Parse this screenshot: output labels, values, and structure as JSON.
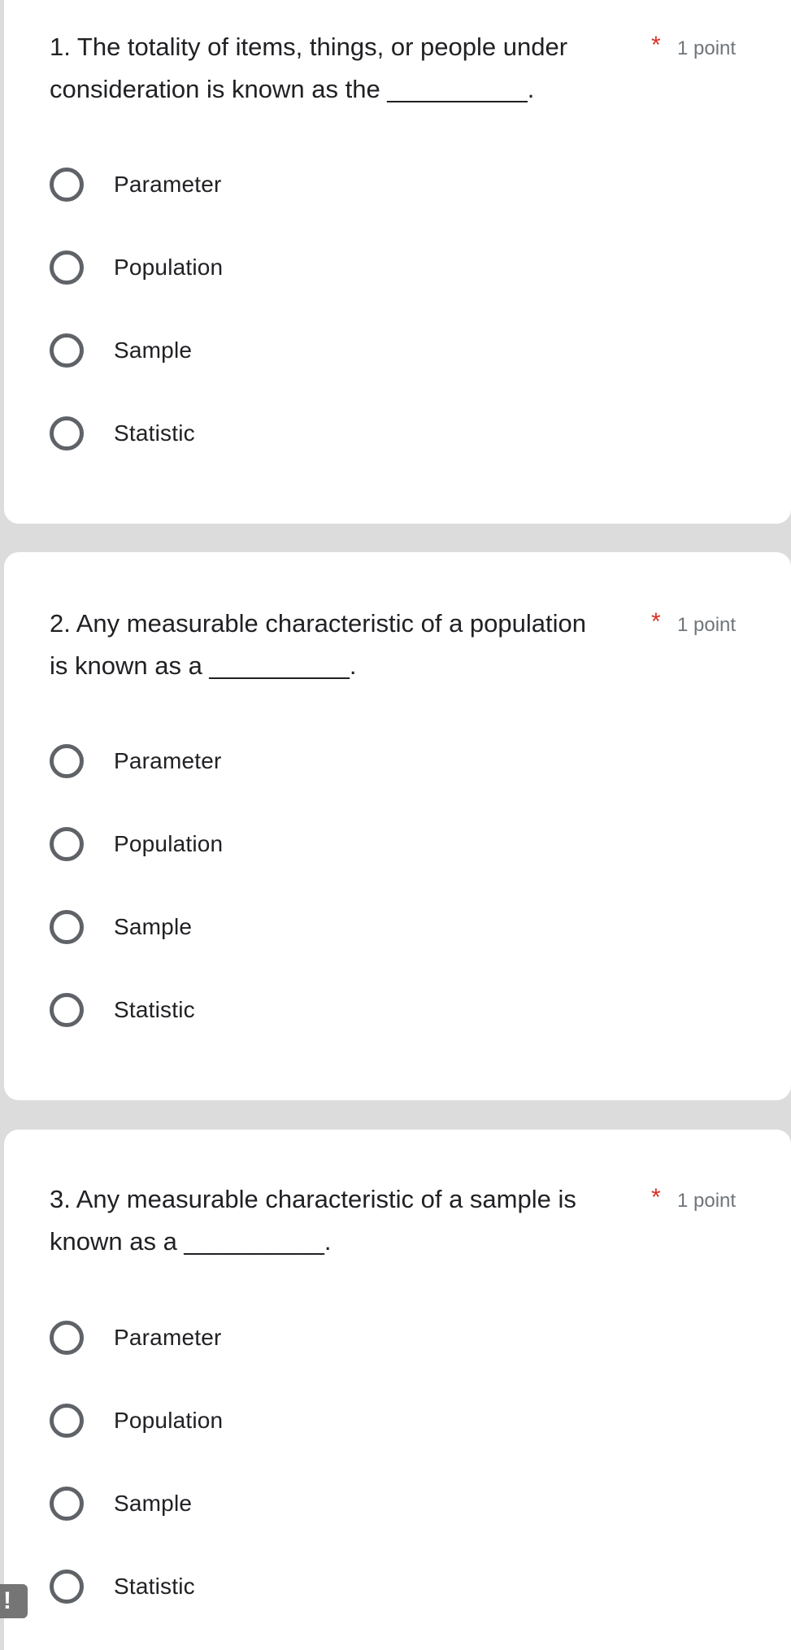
{
  "questions": [
    {
      "number": "1.",
      "text": "1. The totality of items, things, or people under consideration is known as the __________.",
      "required_mark": "*",
      "points": "1 point",
      "options": [
        "Parameter",
        "Population",
        "Sample",
        "Statistic"
      ]
    },
    {
      "number": "2.",
      "text": "2. Any measurable characteristic of a population is known as a __________.",
      "required_mark": "*",
      "points": "1 point",
      "options": [
        "Parameter",
        "Population",
        "Sample",
        "Statistic"
      ]
    },
    {
      "number": "3.",
      "text": "3. Any measurable characteristic of a sample is known as a __________.",
      "required_mark": "*",
      "points": "1 point",
      "options": [
        "Parameter",
        "Population",
        "Sample",
        "Statistic"
      ]
    }
  ],
  "feedback_badge": {
    "label": "!",
    "icon": "exclamation-icon"
  },
  "colors": {
    "background": "#dcdcdc",
    "card": "#ffffff",
    "required": "#d93025",
    "points": "#70757a",
    "radio_border": "#5f6368",
    "text": "#202124"
  }
}
